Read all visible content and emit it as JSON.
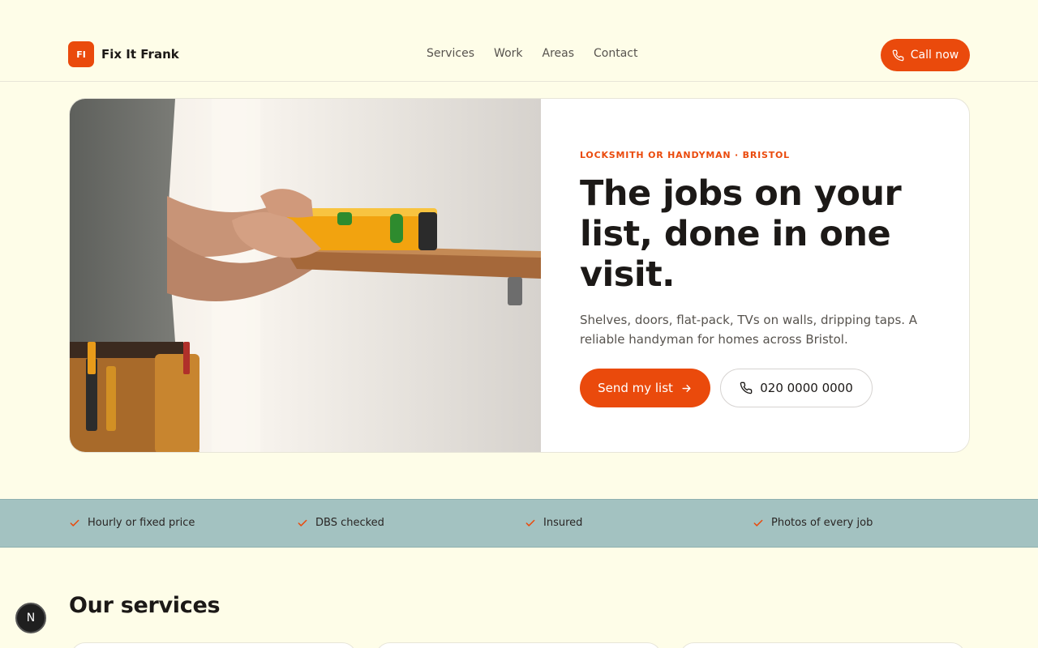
{
  "brand": {
    "initials": "FI",
    "name": "Fix It Frank"
  },
  "nav": {
    "items": [
      "Services",
      "Work",
      "Areas",
      "Contact"
    ]
  },
  "header": {
    "call_label": "Call now"
  },
  "hero": {
    "eyebrow": "LOCKSMITH OR HANDYMAN · BRISTOL",
    "headline": "The jobs on your list, done in one visit.",
    "subtext": "Shelves, doors, flat-pack, TVs on walls, dripping taps. A reliable handyman for homes across Bristol.",
    "primary_label": "Send my list",
    "phone_label": "020 0000 0000"
  },
  "trust": {
    "items": [
      "Hourly or fixed price",
      "DBS checked",
      "Insured",
      "Photos of every job"
    ]
  },
  "services": {
    "title": "Our services"
  },
  "dev_badge": {
    "letter": "N"
  },
  "colors": {
    "accent": "#ea4a0c",
    "page_bg": "#fefde8",
    "strip_bg": "#a3c2c1",
    "text": "#1c1917"
  }
}
